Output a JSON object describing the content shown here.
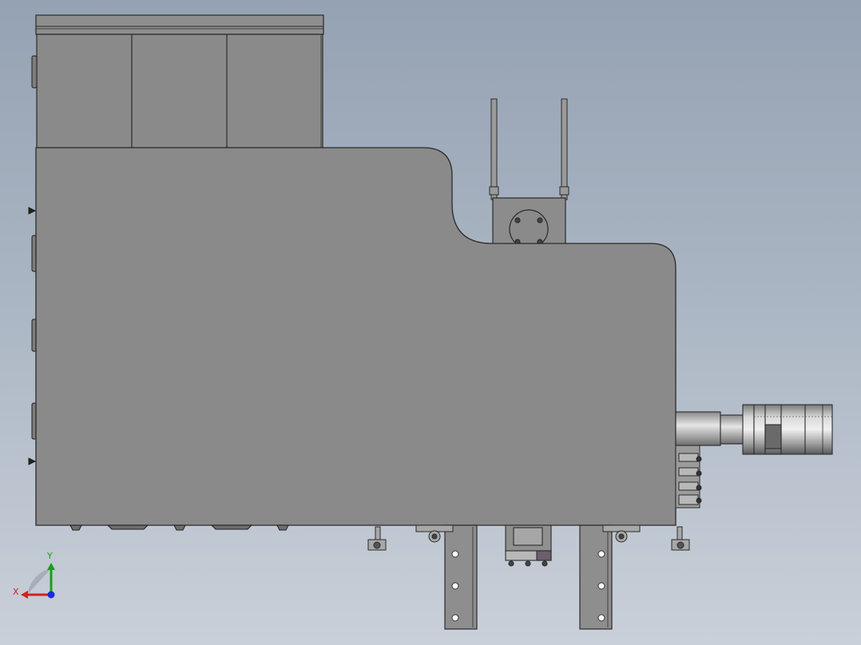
{
  "triad": {
    "x_label": "X",
    "y_label": "Y",
    "x_color": "#d42020",
    "y_color": "#16a016",
    "z_color": "#1a2ed8"
  },
  "colors": {
    "background_top": "#95a2b3",
    "background_bottom": "#c9d0d9",
    "body_fill": "#8a8a8a",
    "edge": "#2a2a2a",
    "frame_fill": "#8e8e8e",
    "motor_fill": "#b4b4b4"
  }
}
